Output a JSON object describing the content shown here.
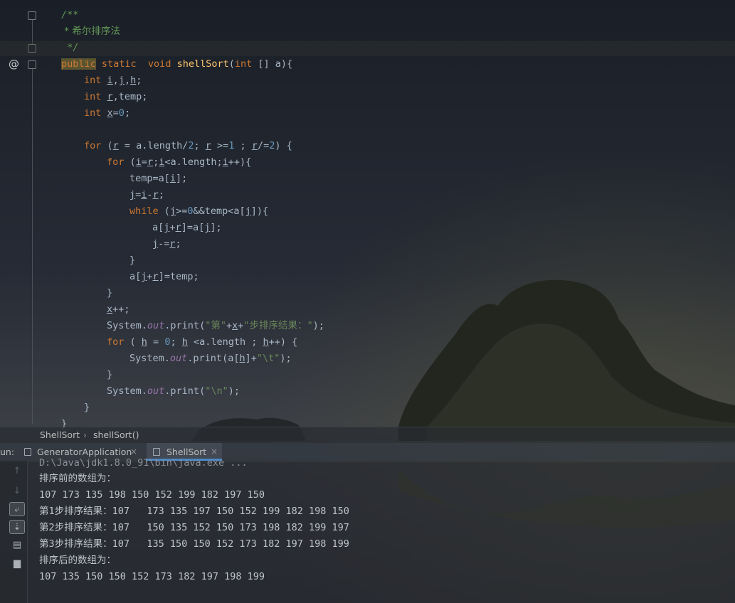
{
  "editor": {
    "lines": [
      {
        "indent": 0,
        "tokens": [
          {
            "t": "/**",
            "c": "cm"
          }
        ]
      },
      {
        "indent": 0,
        "tokens": [
          {
            "t": " * 希尔排序法",
            "c": "cmz"
          }
        ]
      },
      {
        "indent": 0,
        "tokens": [
          {
            "t": " */",
            "c": "cm"
          }
        ]
      },
      {
        "indent": 0,
        "tokens": [
          {
            "t": "public",
            "c": "pub"
          },
          {
            "t": " static  void ",
            "c": "kw"
          },
          {
            "t": "shellSort",
            "c": "fn"
          },
          {
            "t": "(",
            "c": "tr"
          },
          {
            "t": "int",
            "c": "kw"
          },
          {
            "t": " [] a){",
            "c": "tr"
          }
        ]
      },
      {
        "indent": 1,
        "tokens": [
          {
            "t": "int ",
            "c": "kw"
          },
          {
            "t": "i",
            "c": "var"
          },
          {
            "t": ",",
            "c": "tr"
          },
          {
            "t": "j",
            "c": "var"
          },
          {
            "t": ",",
            "c": "tr"
          },
          {
            "t": "h",
            "c": "var"
          },
          {
            "t": ";",
            "c": "tr"
          }
        ]
      },
      {
        "indent": 1,
        "tokens": [
          {
            "t": "int ",
            "c": "kw"
          },
          {
            "t": "r",
            "c": "var"
          },
          {
            "t": ",temp;",
            "c": "tr"
          }
        ]
      },
      {
        "indent": 1,
        "tokens": [
          {
            "t": "int ",
            "c": "kw"
          },
          {
            "t": "x",
            "c": "var"
          },
          {
            "t": "=",
            "c": "tr"
          },
          {
            "t": "0",
            "c": "num"
          },
          {
            "t": ";",
            "c": "tr"
          }
        ]
      },
      {
        "indent": 0,
        "tokens": []
      },
      {
        "indent": 1,
        "tokens": [
          {
            "t": "for ",
            "c": "kw"
          },
          {
            "t": "(",
            "c": "tr"
          },
          {
            "t": "r",
            "c": "var"
          },
          {
            "t": " = a.length/",
            "c": "tr"
          },
          {
            "t": "2",
            "c": "num"
          },
          {
            "t": "; ",
            "c": "tr"
          },
          {
            "t": "r",
            "c": "var"
          },
          {
            "t": " >=",
            "c": "tr"
          },
          {
            "t": "1",
            "c": "num"
          },
          {
            "t": " ; ",
            "c": "tr"
          },
          {
            "t": "r",
            "c": "var"
          },
          {
            "t": "/=",
            "c": "tr"
          },
          {
            "t": "2",
            "c": "num"
          },
          {
            "t": ") {",
            "c": "tr"
          }
        ]
      },
      {
        "indent": 2,
        "tokens": [
          {
            "t": "for ",
            "c": "kw"
          },
          {
            "t": "(",
            "c": "tr"
          },
          {
            "t": "i",
            "c": "var"
          },
          {
            "t": "=",
            "c": "tr"
          },
          {
            "t": "r",
            "c": "var"
          },
          {
            "t": ";",
            "c": "tr"
          },
          {
            "t": "i",
            "c": "var"
          },
          {
            "t": "<a.length;",
            "c": "tr"
          },
          {
            "t": "i",
            "c": "var"
          },
          {
            "t": "++){",
            "c": "tr"
          }
        ]
      },
      {
        "indent": 3,
        "tokens": [
          {
            "t": "temp=a[",
            "c": "tr"
          },
          {
            "t": "i",
            "c": "var"
          },
          {
            "t": "];",
            "c": "tr"
          }
        ]
      },
      {
        "indent": 3,
        "tokens": [
          {
            "t": "j",
            "c": "var"
          },
          {
            "t": "=",
            "c": "tr"
          },
          {
            "t": "i",
            "c": "var"
          },
          {
            "t": "-",
            "c": "tr"
          },
          {
            "t": "r",
            "c": "var"
          },
          {
            "t": ";",
            "c": "tr"
          }
        ]
      },
      {
        "indent": 3,
        "tokens": [
          {
            "t": "while ",
            "c": "kw"
          },
          {
            "t": "(",
            "c": "tr"
          },
          {
            "t": "j",
            "c": "var"
          },
          {
            "t": ">=",
            "c": "tr"
          },
          {
            "t": "0",
            "c": "num"
          },
          {
            "t": "&&temp<a[",
            "c": "tr"
          },
          {
            "t": "j",
            "c": "var"
          },
          {
            "t": "]){",
            "c": "tr"
          }
        ]
      },
      {
        "indent": 4,
        "tokens": [
          {
            "t": "a[",
            "c": "tr"
          },
          {
            "t": "j",
            "c": "var"
          },
          {
            "t": "+",
            "c": "tr"
          },
          {
            "t": "r",
            "c": "var"
          },
          {
            "t": "]=a[",
            "c": "tr"
          },
          {
            "t": "j",
            "c": "var"
          },
          {
            "t": "];",
            "c": "tr"
          }
        ]
      },
      {
        "indent": 4,
        "tokens": [
          {
            "t": "j",
            "c": "var"
          },
          {
            "t": "-=",
            "c": "tr"
          },
          {
            "t": "r",
            "c": "var"
          },
          {
            "t": ";",
            "c": "tr"
          }
        ]
      },
      {
        "indent": 3,
        "tokens": [
          {
            "t": "}",
            "c": "tr"
          }
        ]
      },
      {
        "indent": 3,
        "tokens": [
          {
            "t": "a[",
            "c": "tr"
          },
          {
            "t": "j",
            "c": "var"
          },
          {
            "t": "+",
            "c": "tr"
          },
          {
            "t": "r",
            "c": "var"
          },
          {
            "t": "]=temp;",
            "c": "tr"
          }
        ]
      },
      {
        "indent": 2,
        "tokens": [
          {
            "t": "}",
            "c": "tr"
          }
        ]
      },
      {
        "indent": 2,
        "tokens": [
          {
            "t": "x",
            "c": "var"
          },
          {
            "t": "++;",
            "c": "tr"
          }
        ]
      },
      {
        "indent": 2,
        "tokens": [
          {
            "t": "System.",
            "c": "tr"
          },
          {
            "t": "out",
            "c": "out"
          },
          {
            "t": ".print(",
            "c": "tr"
          },
          {
            "t": "\"第\"",
            "c": "str"
          },
          {
            "t": "+",
            "c": "tr"
          },
          {
            "t": "x",
            "c": "var"
          },
          {
            "t": "+",
            "c": "tr"
          },
          {
            "t": "\"步排序结果：\"",
            "c": "str"
          },
          {
            "t": ");",
            "c": "tr"
          }
        ]
      },
      {
        "indent": 2,
        "tokens": [
          {
            "t": "for ",
            "c": "kw"
          },
          {
            "t": "( ",
            "c": "tr"
          },
          {
            "t": "h",
            "c": "var"
          },
          {
            "t": " = ",
            "c": "tr"
          },
          {
            "t": "0",
            "c": "num"
          },
          {
            "t": "; ",
            "c": "tr"
          },
          {
            "t": "h",
            "c": "var"
          },
          {
            "t": " <a.length ; ",
            "c": "tr"
          },
          {
            "t": "h",
            "c": "var"
          },
          {
            "t": "++) {",
            "c": "tr"
          }
        ]
      },
      {
        "indent": 3,
        "tokens": [
          {
            "t": "System.",
            "c": "tr"
          },
          {
            "t": "out",
            "c": "out"
          },
          {
            "t": ".print(a[",
            "c": "tr"
          },
          {
            "t": "h",
            "c": "var"
          },
          {
            "t": "]+",
            "c": "tr"
          },
          {
            "t": "\"\\t\"",
            "c": "str"
          },
          {
            "t": ");",
            "c": "tr"
          }
        ]
      },
      {
        "indent": 2,
        "tokens": [
          {
            "t": "}",
            "c": "tr"
          }
        ]
      },
      {
        "indent": 2,
        "tokens": [
          {
            "t": "System.",
            "c": "tr"
          },
          {
            "t": "out",
            "c": "out"
          },
          {
            "t": ".print(",
            "c": "tr"
          },
          {
            "t": "\"\\n\"",
            "c": "str"
          },
          {
            "t": ");",
            "c": "tr"
          }
        ]
      },
      {
        "indent": 1,
        "tokens": [
          {
            "t": "}",
            "c": "tr"
          }
        ]
      },
      {
        "indent": 0,
        "tokens": [
          {
            "t": "}",
            "c": "tr"
          }
        ]
      }
    ],
    "gutter_marker": "@"
  },
  "breadcrumb": {
    "class_name": "ShellSort",
    "separator": "›",
    "method_name": "shellSort()"
  },
  "run_panel": {
    "label": "un:",
    "tabs": [
      {
        "label": "GeneratorApplication",
        "close": "×",
        "active": false
      },
      {
        "label": "ShellSort",
        "close": "×",
        "active": true
      }
    ],
    "side_icons": [
      "arrow-up-icon",
      "arrow-down-icon",
      "soft-wrap-icon",
      "scroll-to-end-icon",
      "print-icon",
      "trash-icon"
    ]
  },
  "console": {
    "command": "D:\\Java\\jdk1.8.0_91\\bin\\java.exe ...",
    "lines": [
      "排序前的数组为：",
      "107 173 135 198 150 152 199 182 197 150",
      "第1步排序结果：107   173 135 197 150 152 199 182 198 150",
      "第2步排序结果：107   150 135 152 150 173 198 182 199 197",
      "第3步排序结果：107   135 150 150 152 173 182 197 198 199",
      "排序后的数组为：",
      "107 135 150 150 152 173 182 197 198 199"
    ]
  }
}
